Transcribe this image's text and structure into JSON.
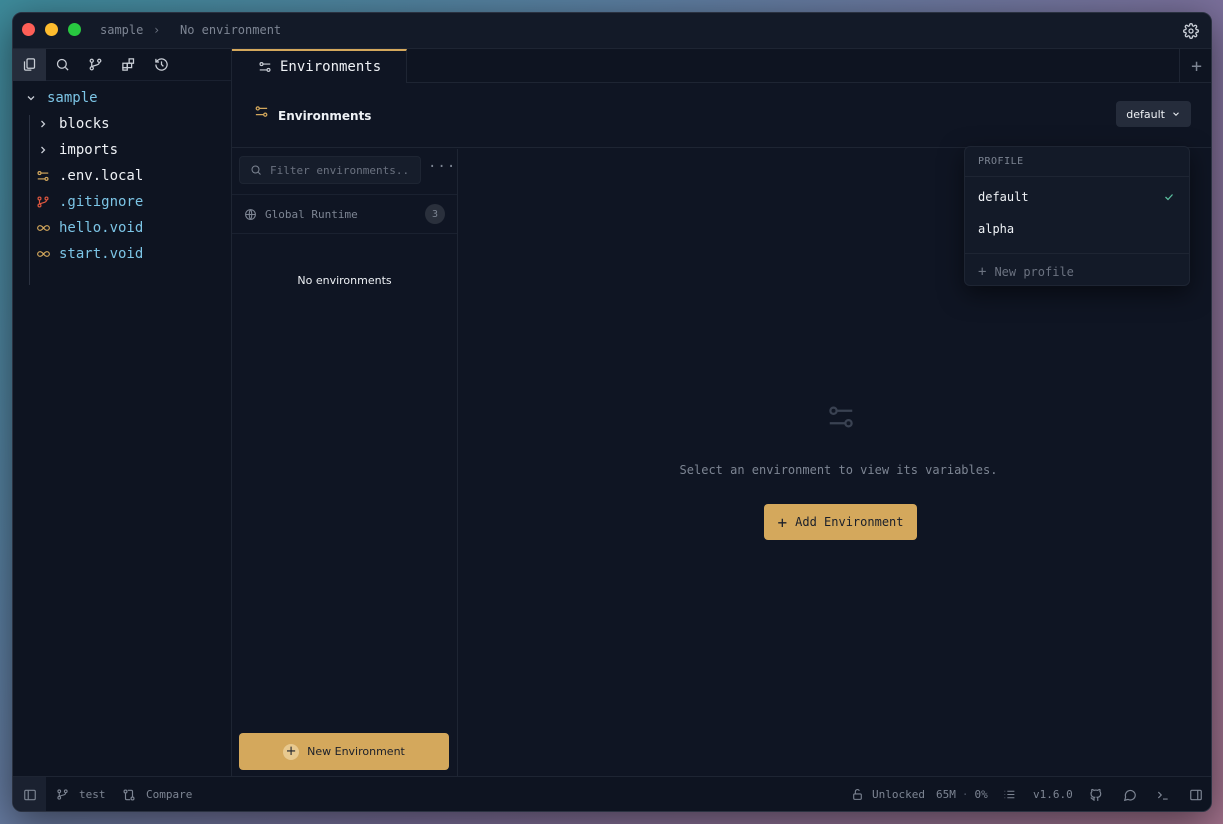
{
  "titlebar": {
    "project": "sample",
    "environment": "No environment"
  },
  "sidebar": {
    "tree": [
      {
        "label": "sample",
        "kind": "root-folder",
        "color": "#7cc5e6"
      },
      {
        "label": "blocks",
        "kind": "folder",
        "color": "#eef1f5"
      },
      {
        "label": "imports",
        "kind": "folder",
        "color": "#eef1f5"
      },
      {
        "label": ".env.local",
        "kind": "env-file",
        "color": "#eef1f5"
      },
      {
        "label": ".gitignore",
        "kind": "git-file",
        "color": "#7cc5e6"
      },
      {
        "label": "hello.void",
        "kind": "void-file",
        "color": "#7cc5e6"
      },
      {
        "label": "start.void",
        "kind": "void-file",
        "color": "#7cc5e6"
      }
    ]
  },
  "tabs": [
    {
      "label": "Environments",
      "active": true
    }
  ],
  "env_header": {
    "title": "Environments",
    "profile_selected": "default"
  },
  "env_list": {
    "search_placeholder": "Filter environments...",
    "global_label": "Global Runtime",
    "global_count": "3",
    "empty_text": "No environments",
    "new_button": "New Environment"
  },
  "detail": {
    "message": "Select an environment to view its variables.",
    "add_button": "Add Environment"
  },
  "profile_menu": {
    "heading": "PROFILE",
    "items": [
      {
        "label": "default",
        "checked": true
      },
      {
        "label": "alpha",
        "checked": false
      }
    ],
    "new_label": "New profile"
  },
  "statusbar": {
    "branch": "test",
    "compare": "Compare",
    "lock": "Unlocked",
    "memory": "65M",
    "cpu": "0%",
    "version": "v1.6.0"
  },
  "colors": {
    "accent": "#d4a85c",
    "background": "#0f1523",
    "check": "#5bbfa0",
    "git_icon": "#e0573f",
    "env_icon": "#d4a85c"
  }
}
